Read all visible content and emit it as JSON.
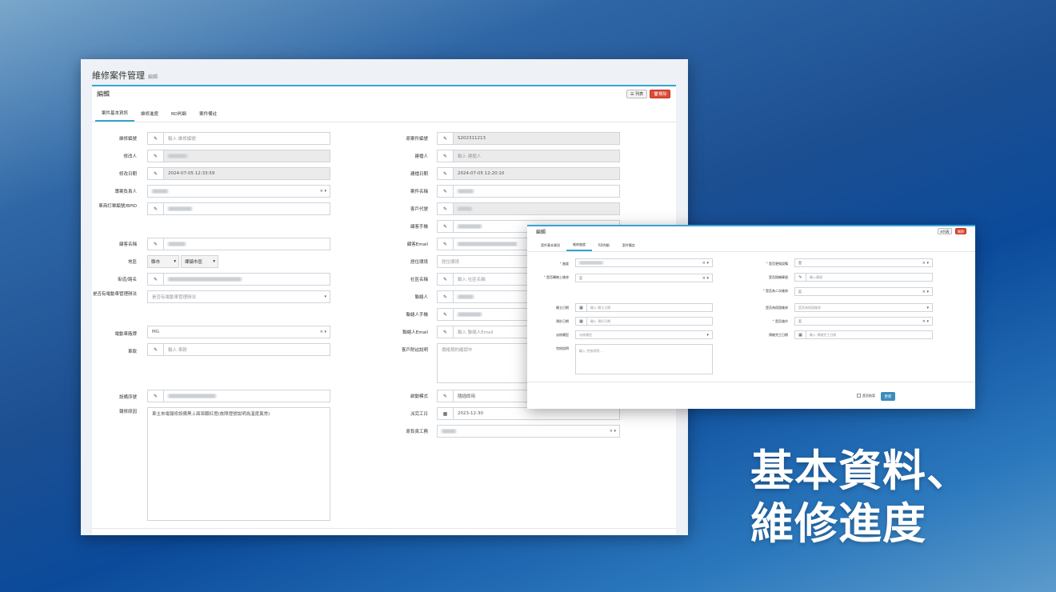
{
  "main_window": {
    "title": "維修案件管理",
    "subtitle": "編輯",
    "panel_title": "編輯",
    "list_button": "列表",
    "delete_button": "刪除",
    "tabs": [
      "案件基本資訊",
      "維修進度",
      "RD判斷",
      "案件備註"
    ],
    "left_fields": [
      {
        "label": "維修編號",
        "value": "",
        "placeholder": "輸入 維修編號"
      },
      {
        "label": "修改人",
        "value": "",
        "placeholder": ""
      },
      {
        "label": "修改日期",
        "value": "2024-07-05 12:33:59",
        "placeholder": ""
      },
      {
        "label": "專案負責人",
        "value": "",
        "placeholder": ""
      },
      {
        "label": "車商訂單編號/BPID",
        "value": "",
        "placeholder": ""
      },
      {
        "label": "顧客名稱",
        "value": "",
        "placeholder": ""
      },
      {
        "label": "地區",
        "value": "",
        "placeholder": ""
      },
      {
        "label": "街道/路名",
        "value": "",
        "placeholder": ""
      },
      {
        "label": "是否有電動車管理辦法",
        "value": "",
        "placeholder": "是否有電動車管理辦法"
      },
      {
        "label": "電動車廠牌",
        "value": "MG",
        "placeholder": ""
      },
      {
        "label": "車款",
        "value": "",
        "placeholder": "輸入 車款"
      },
      {
        "label": "設備序號",
        "value": "",
        "placeholder": ""
      },
      {
        "label": "報修原因",
        "value": "車主來電報修設備黑上面兩顆紅燈(故障燈號說明為溫度異常)",
        "placeholder": ""
      }
    ],
    "region_city": "縣市",
    "region_district": "鄉鎮市區",
    "right_fields": [
      {
        "label": "原案件編號",
        "value": "S202311213",
        "placeholder": ""
      },
      {
        "label": "建檔人",
        "value": "",
        "placeholder": "輸入 建檔人"
      },
      {
        "label": "建檔日期",
        "value": "2024-07-05 12:20:10",
        "placeholder": ""
      },
      {
        "label": "案件名稱",
        "value": "",
        "placeholder": ""
      },
      {
        "label": "客戶代號",
        "value": "",
        "placeholder": ""
      },
      {
        "label": "顧客手機",
        "value": "",
        "placeholder": ""
      },
      {
        "label": "顧客Email",
        "value": "",
        "placeholder": ""
      },
      {
        "label": "居住環境",
        "value": "",
        "placeholder": "居住環境"
      },
      {
        "label": "社區名稱",
        "value": "",
        "placeholder": "輸入 社區名稱"
      },
      {
        "label": "聯絡人",
        "value": "",
        "placeholder": ""
      },
      {
        "label": "聯絡人手機",
        "value": "",
        "placeholder": ""
      },
      {
        "label": "聯絡人Email",
        "value": "",
        "placeholder": "輸入 聯絡人Email"
      },
      {
        "label": "客戶附註說明",
        "value": "",
        "placeholder": "價格預約確認中"
      },
      {
        "label": "啟動模式",
        "value": "隨插即用",
        "placeholder": ""
      },
      {
        "label": "派完工日",
        "value": "2023-12-30",
        "placeholder": ""
      },
      {
        "label": "原負責工務",
        "value": "",
        "placeholder": ""
      }
    ]
  },
  "overlay_window": {
    "panel_title": "編輯",
    "list_button": "列表",
    "delete_button": "刪除",
    "tabs": [
      "案件基本資訊",
      "維修進度",
      "RD判斷",
      "案件備註"
    ],
    "left_fields": [
      {
        "label": "* 進度",
        "value": "",
        "placeholder": ""
      },
      {
        "label": "* 是否轉線上維修",
        "value": "否",
        "placeholder": ""
      },
      {
        "label": "開立日期",
        "value": "",
        "placeholder": "輸入 開立日期"
      },
      {
        "label": "預計日期",
        "value": "",
        "placeholder": "輸入 預計日期"
      },
      {
        "label": "派修類型",
        "value": "",
        "placeholder": "派修類型"
      },
      {
        "label": "完修說明",
        "value": "",
        "placeholder": "輸入 完修說明..."
      }
    ],
    "right_fields": [
      {
        "label": "* 是否更換設備",
        "value": "是",
        "placeholder": ""
      },
      {
        "label": "是否換機庫號",
        "value": "",
        "placeholder": "輸入庫號"
      },
      {
        "label": "* 是否為二次維修",
        "value": "否",
        "placeholder": ""
      },
      {
        "label": "是否為保固維修",
        "value": "",
        "placeholder": "是否為保固維修"
      },
      {
        "label": "* 是否施作",
        "value": "否",
        "placeholder": ""
      },
      {
        "label": "傳維完工日期",
        "value": "",
        "placeholder": "輸入 傳維完工日期"
      }
    ],
    "check_label": "是否結案",
    "save_button": "更新"
  },
  "caption": {
    "line1": "基本資料、",
    "line2": "維修進度"
  },
  "colors": {
    "accent": "#38a3d6",
    "danger": "#dd4b39",
    "primary": "#3c8dbc"
  }
}
